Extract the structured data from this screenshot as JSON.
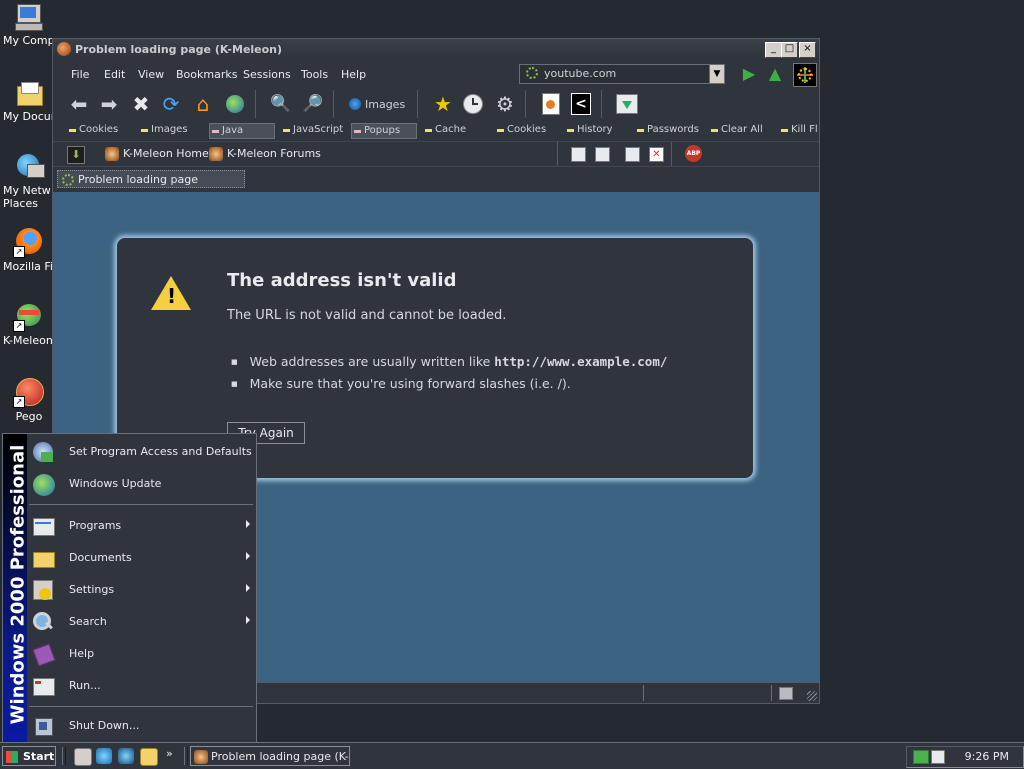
{
  "desktop": {
    "icons": [
      {
        "label": "My Compu",
        "icon": "computer-icon"
      },
      {
        "label": "My Docum",
        "icon": "folder-icon"
      },
      {
        "label": "My Netw",
        "label2": "Places",
        "icon": "network-icon"
      },
      {
        "label": "Mozilla Fire",
        "icon": "firefox-icon"
      },
      {
        "label": "K-Meleon",
        "icon": "kmeleon-icon"
      },
      {
        "label": "Pego",
        "icon": "pego-icon"
      }
    ]
  },
  "window": {
    "title": "Problem loading page (K-Meleon)",
    "buttons": {
      "minimize": "_",
      "maximize": "□",
      "close": "×"
    }
  },
  "menubar": {
    "items": [
      "File",
      "Edit",
      "View",
      "Bookmarks",
      "Sessions",
      "Tools",
      "Help"
    ],
    "url_value": "youtube.com"
  },
  "toolbar": {
    "images_label": "Images"
  },
  "prefbar": {
    "items": [
      "Cookies",
      "Images",
      "Java",
      "JavaScript",
      "Popups",
      "Cache",
      "Cookies",
      "History",
      "Passwords",
      "Clear All",
      "Kill Fl"
    ]
  },
  "bookmarks": {
    "items": [
      "K-Meleon Home",
      "K-Meleon Forums"
    ]
  },
  "tab": {
    "label": "Problem loading page"
  },
  "error": {
    "title": "The address isn't valid",
    "description": "The URL is not valid and cannot be loaded.",
    "bullet1_prefix": "Web addresses are usually written like ",
    "bullet1_example": "http://www.example.com/",
    "bullet2": "Make sure that you're using forward slashes (i.e. /).",
    "try_again": "Try Again"
  },
  "startmenu": {
    "banner": "Windows 2000 Professional",
    "top_items": [
      "Set Program Access and Defaults",
      "Windows Update"
    ],
    "items": [
      "Programs",
      "Documents",
      "Settings",
      "Search",
      "Help",
      "Run..."
    ],
    "shutdown": "Shut Down..."
  },
  "taskbar": {
    "start_label": "Start",
    "task_label": "Problem loading page (K-...",
    "clock": "9:26 PM"
  }
}
